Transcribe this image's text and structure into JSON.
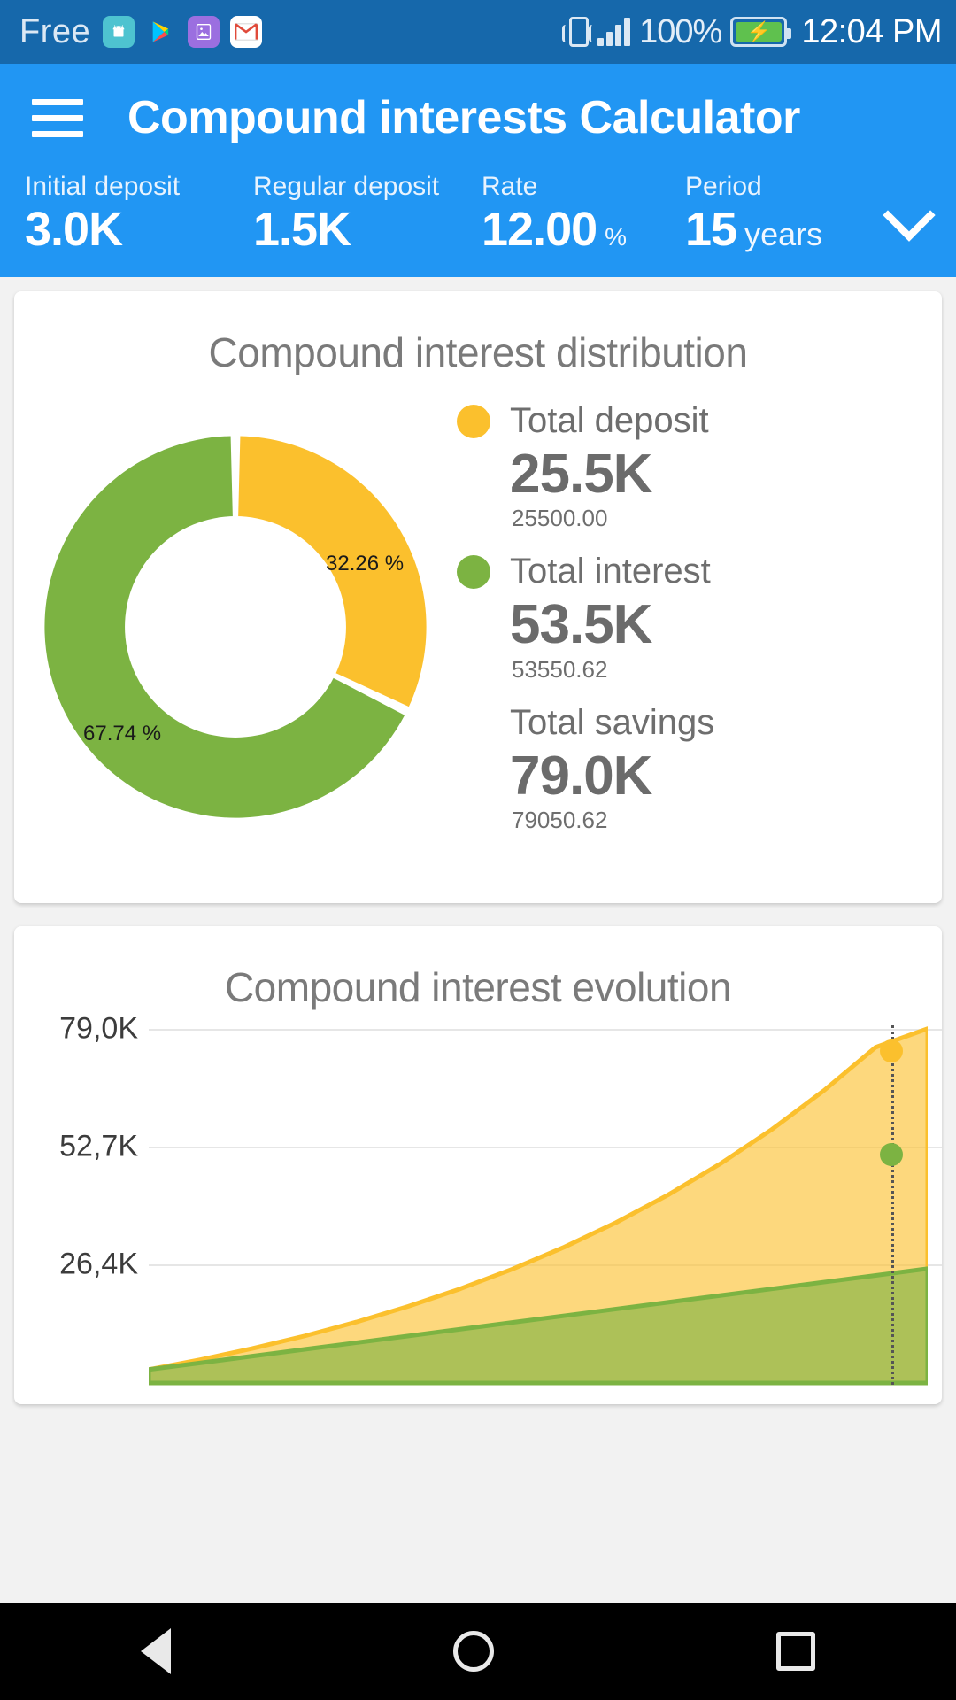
{
  "statusbar": {
    "carrier": "Free",
    "icons": [
      "android-icon",
      "google-play-icon",
      "google-photos-icon",
      "gmail-icon"
    ],
    "vibrate_icon": "vibrate-icon",
    "signal_icon": "signal-bars-icon",
    "battery_percent": "100%",
    "battery_icon": "battery-charging-icon",
    "time": "12:04 PM"
  },
  "appbar": {
    "menu_icon": "hamburger-menu-icon",
    "title": "Compound interests Calculator",
    "expand_icon": "chevron-down-icon",
    "params": [
      {
        "label": "Initial deposit",
        "value": "3.0K",
        "unit": ""
      },
      {
        "label": "Regular deposit",
        "value": "1.5K",
        "unit": ""
      },
      {
        "label": "Rate",
        "value": "12.00",
        "unit": "%"
      },
      {
        "label": "Period",
        "value": "15",
        "unit": "years"
      }
    ]
  },
  "distribution_card": {
    "title": "Compound interest distribution",
    "legend": [
      {
        "name": "Total deposit",
        "big": "25.5K",
        "exact": "25500.00",
        "color": "#fbc02d",
        "has_dot": true
      },
      {
        "name": "Total interest",
        "big": "53.5K",
        "exact": "53550.62",
        "color": "#7cb342",
        "has_dot": true
      },
      {
        "name": "Total savings",
        "big": "79.0K",
        "exact": "79050.62",
        "color": "",
        "has_dot": false
      }
    ]
  },
  "evolution_card": {
    "title": "Compound interest evolution"
  },
  "navbar": {
    "back_icon": "back-triangle-icon",
    "home_icon": "home-circle-icon",
    "recents_icon": "recents-square-icon"
  },
  "colors": {
    "status_bar": "#1668ab",
    "app_bar": "#2196f3",
    "deposit_yellow": "#fbc02d",
    "interest_green": "#7cb342",
    "page_bg": "#f2f2f2",
    "card_bg": "#ffffff",
    "text_gray": "#6e6e6e"
  },
  "chart_data": [
    {
      "type": "pie",
      "variant": "donut",
      "title": "Compound interest distribution",
      "labels": [
        "Total deposit",
        "Total interest"
      ],
      "values": [
        25500.0,
        53550.62
      ],
      "percents": [
        32.26,
        67.74
      ],
      "percent_labels": [
        "32.26 %",
        "67.74 %"
      ],
      "colors": [
        "#fbc02d",
        "#7cb342"
      ],
      "total": 79050.62,
      "start_angle": 0,
      "direction": "clockwise",
      "inner_radius_ratio": 0.52,
      "legend": "right"
    },
    {
      "type": "area",
      "variant": "stacked",
      "title": "Compound interest evolution",
      "xlabel": "",
      "ylabel": "",
      "grid": true,
      "legend": "none",
      "yticks": [
        26400,
        52700,
        79000
      ],
      "ytick_labels": [
        "26,4K",
        "52,7K",
        "79,0K"
      ],
      "ylim": [
        0,
        79000
      ],
      "xlim": [
        0,
        15
      ],
      "x": [
        0,
        1,
        2,
        3,
        4,
        5,
        6,
        7,
        8,
        9,
        10,
        11,
        12,
        13,
        14,
        15
      ],
      "series": [
        {
          "name": "Total savings",
          "color": "#fbc02d",
          "values": [
            3000,
            5220,
            7706,
            10491,
            13610,
            17103,
            21015,
            25397,
            30304,
            35800,
            41956,
            48851,
            56573,
            65222,
            74909,
            79050
          ]
        },
        {
          "name": "Total deposit",
          "color": "#7cb342",
          "values": [
            3000,
            4500,
            6000,
            7500,
            9000,
            10500,
            12000,
            13500,
            15000,
            16500,
            18000,
            19500,
            21000,
            22500,
            24000,
            25500
          ]
        }
      ],
      "marker": {
        "x": 14.3,
        "points": [
          {
            "y": 74000,
            "color": "#fbc02d"
          },
          {
            "y": 51000,
            "color": "#7cb342"
          }
        ],
        "line_style": "dotted"
      }
    }
  ]
}
